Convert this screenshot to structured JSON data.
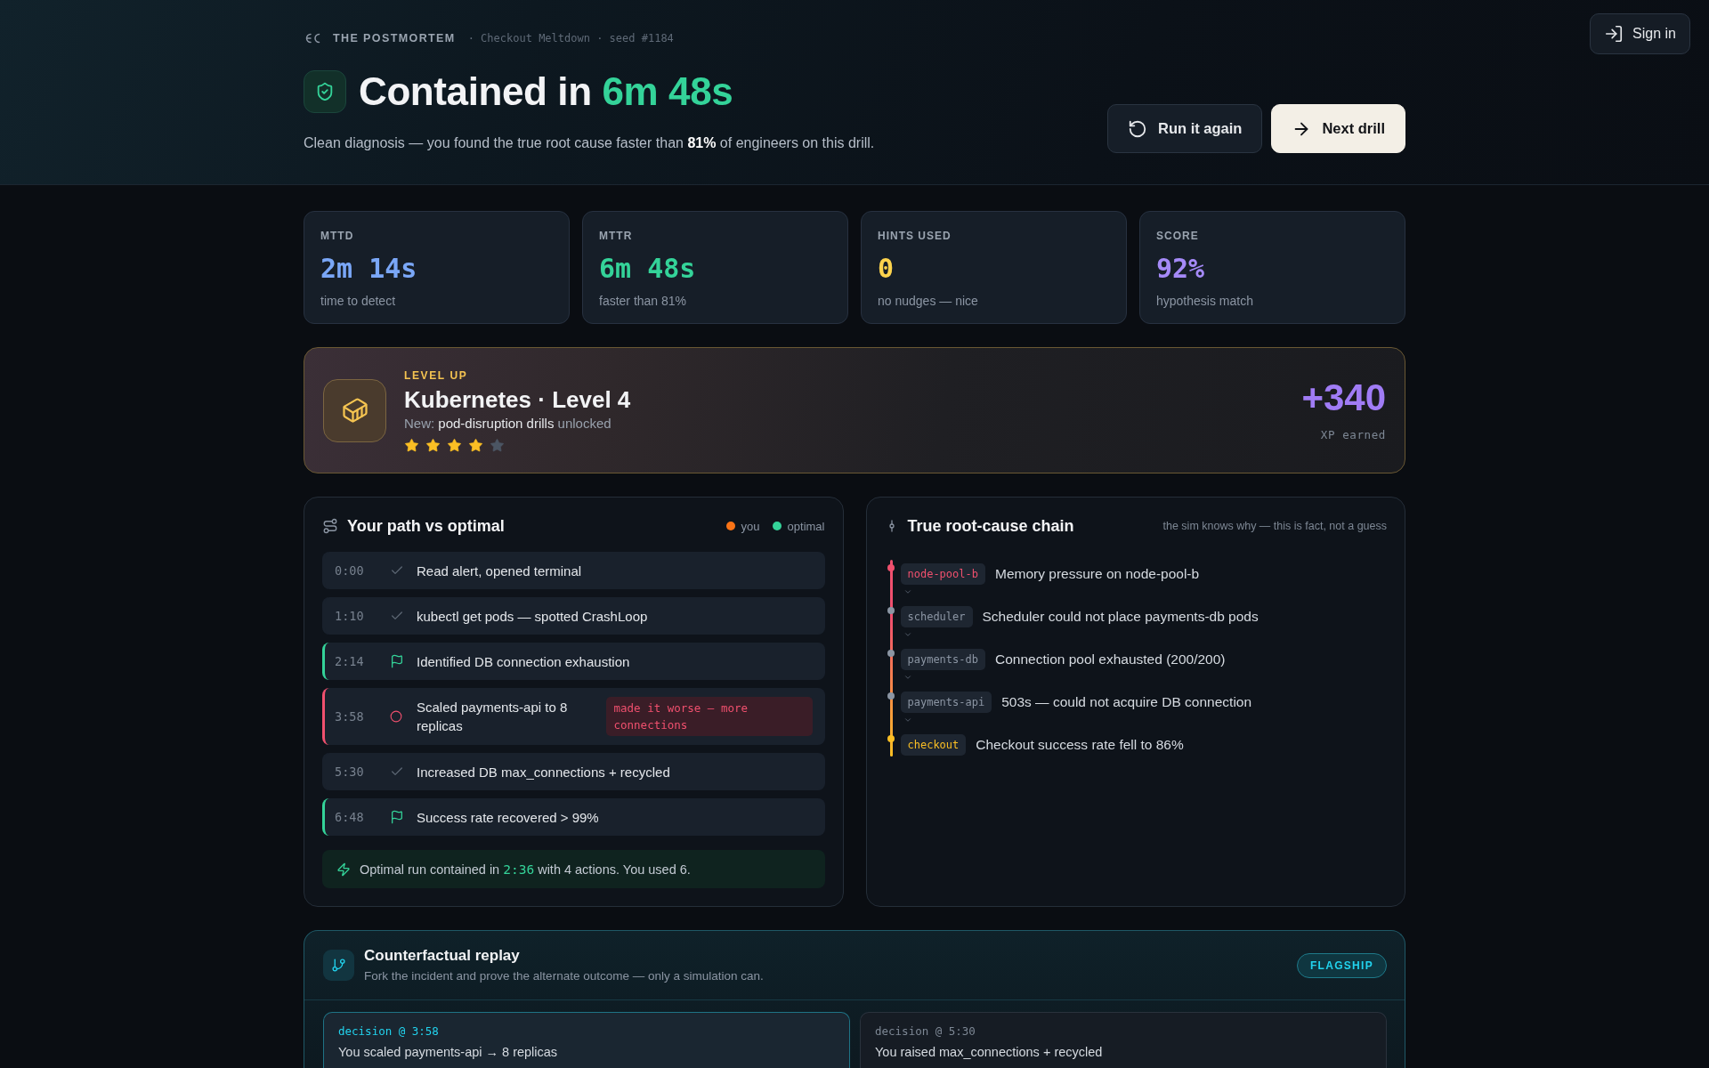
{
  "header": {
    "brand": "THE POSTMORTEM",
    "meta": "· Checkout Meltdown · seed #1184",
    "headline": "Contained in **6m 48s**",
    "summary": "Clean diagnosis — you found the true root cause faster than **81%** of engineers on this drill.",
    "actions": [
      {
        "label": "Run it again",
        "kind": "secondary"
      },
      {
        "label": "Next drill",
        "kind": "primary"
      }
    ],
    "sign_in": "Sign in"
  },
  "stats": [
    {
      "label": "MTTD",
      "value": "2m 14s",
      "caption": "time to detect",
      "color": "#7aa7f7"
    },
    {
      "label": "MTTR",
      "value": "6m 48s",
      "caption": "faster than 81%",
      "color": "#34d399"
    },
    {
      "label": "HINTS USED",
      "value": "0",
      "caption": "no nudges — nice",
      "color": "#fcd34d"
    },
    {
      "label": "SCORE",
      "value": "92%",
      "caption": "hypothesis match",
      "color": "#a58af8"
    }
  ],
  "level_up": {
    "eyebrow": "LEVEL UP",
    "title": "Kubernetes · Level 4",
    "unlock": "New: **pod-disruption drills** unlocked",
    "stars": 4,
    "xp": "+340",
    "xp_label": "XP earned"
  },
  "path": {
    "title": "Your path vs optimal",
    "legend": [
      {
        "label": "you",
        "color": "#f97316"
      },
      {
        "label": "optimal",
        "color": "#34d399"
      }
    ],
    "steps": [
      {
        "time": "0:00",
        "kind": "step",
        "text": "Read alert, opened terminal"
      },
      {
        "time": "1:10",
        "kind": "step",
        "text": "kubectl get pods — spotted CrashLoop"
      },
      {
        "time": "2:14",
        "kind": "milestone",
        "text": "Identified DB connection exhaustion"
      },
      {
        "time": "3:58",
        "kind": "misstep",
        "text": "Scaled payments-api to 8 replicas",
        "note": "made it worse — more connections"
      },
      {
        "time": "5:30",
        "kind": "step",
        "text": "Increased DB max_connections + recycled"
      },
      {
        "time": "6:48",
        "kind": "milestone",
        "text": "Success rate recovered > 99%"
      }
    ],
    "summary": "Optimal run contained in **2:36** with 4 actions. You used 6."
  },
  "root_cause": {
    "title": "True root-cause chain",
    "note": "the sim knows why — this is fact, not a guess",
    "links": [
      {
        "component": "node-pool-b",
        "description": "Memory pressure on node-pool-b",
        "color": "#f0506e"
      },
      {
        "component": "scheduler",
        "description": "Scheduler could not place payments-db pods",
        "color": "#8b95a3"
      },
      {
        "component": "payments-db",
        "description": "Connection pool exhausted (200/200)",
        "color": "#8b95a3"
      },
      {
        "component": "payments-api",
        "description": "503s — could not acquire DB connection",
        "color": "#8b95a3"
      },
      {
        "component": "checkout",
        "description": "Checkout success rate fell to 86%",
        "color": "#fbbf24"
      }
    ]
  },
  "counterfactual": {
    "title": "Counterfactual replay",
    "subtitle": "Fork the incident and prove the alternate outcome — only a simulation can.",
    "badge": "FLAGSHIP",
    "decisions": [
      {
        "label": "decision @ 3:58",
        "text": "You scaled payments-api → 8 replicas",
        "selected": true
      },
      {
        "label": "decision @ 5:30",
        "text": "You raised max_connections + recycled",
        "selected": false
      }
    ]
  }
}
